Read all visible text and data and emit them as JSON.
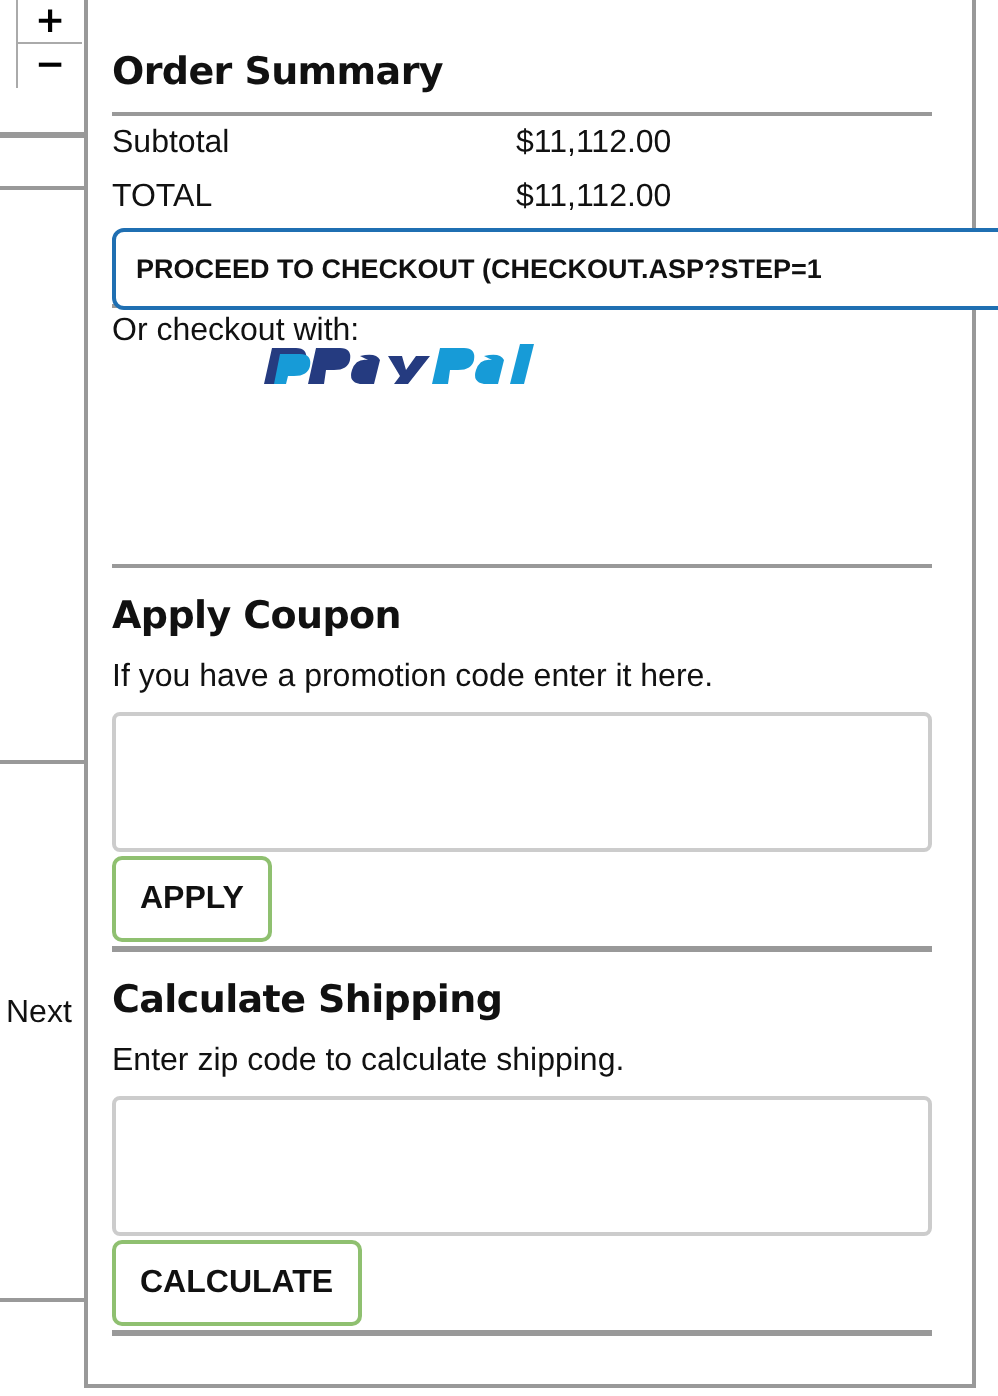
{
  "zoom_controls": [
    "+",
    "−"
  ],
  "side_link": "Next",
  "order_summary": {
    "title": "Order Summary",
    "rows": [
      {
        "label": "Subtotal",
        "value": "$11,112.00"
      },
      {
        "label": "TOTAL",
        "value": "$11,112.00"
      }
    ],
    "checkout_button": "PROCEED TO CHECKOUT (CHECKOUT.ASP?STEP=1",
    "alt_checkout_label": "Or checkout with:"
  },
  "coupon": {
    "title": "Apply Coupon",
    "hint": "If you have a promotion code enter it here.",
    "button": "APPLY"
  },
  "shipping": {
    "title": "Calculate Shipping",
    "hint": "Enter zip code to calculate shipping.",
    "button": "CALCULATE"
  }
}
